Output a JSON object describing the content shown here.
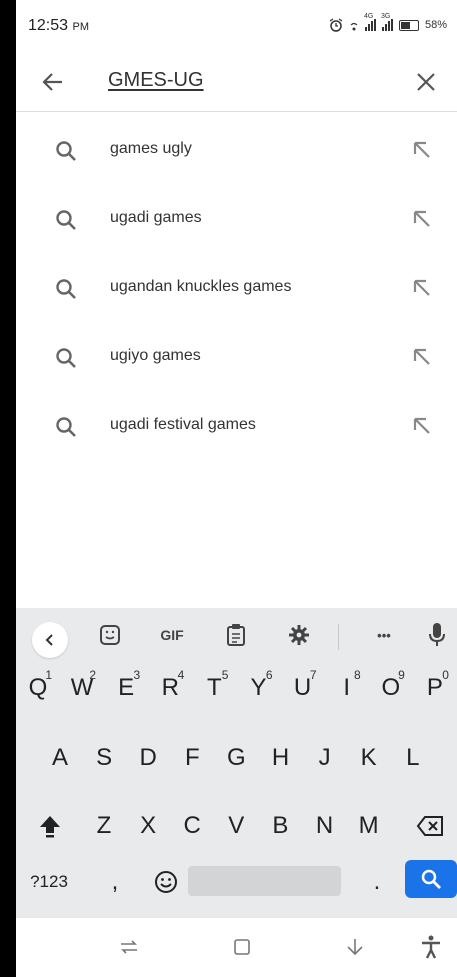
{
  "status_bar": {
    "time": "12:53",
    "ampm": "PM",
    "net_4g": "4G",
    "net_3g": "3G",
    "battery": "58%"
  },
  "search": {
    "query": "GMES-UG",
    "back_icon": "arrow-left-icon",
    "clear_icon": "close-icon"
  },
  "suggestions": [
    {
      "text": "games ugly"
    },
    {
      "text": "ugadi games"
    },
    {
      "text": "ugandan knuckles games"
    },
    {
      "text": "ugiyo games"
    },
    {
      "text": "ugadi festival games"
    }
  ],
  "keyboard": {
    "toolbar": {
      "gif": "GIF",
      "more": "•••"
    },
    "row1": [
      {
        "k": "Q",
        "h": "1"
      },
      {
        "k": "W",
        "h": "2"
      },
      {
        "k": "E",
        "h": "3"
      },
      {
        "k": "R",
        "h": "4"
      },
      {
        "k": "T",
        "h": "5"
      },
      {
        "k": "Y",
        "h": "6"
      },
      {
        "k": "U",
        "h": "7"
      },
      {
        "k": "I",
        "h": "8"
      },
      {
        "k": "O",
        "h": "9"
      },
      {
        "k": "P",
        "h": "0"
      }
    ],
    "row2": [
      "A",
      "S",
      "D",
      "F",
      "G",
      "H",
      "J",
      "K",
      "L"
    ],
    "row3": [
      "Z",
      "X",
      "C",
      "V",
      "B",
      "N",
      "M"
    ],
    "symbols": "?123",
    "comma": ",",
    "period": "."
  },
  "colors": {
    "accent": "#1a73e8",
    "keyboard_bg": "#e9eaec"
  }
}
